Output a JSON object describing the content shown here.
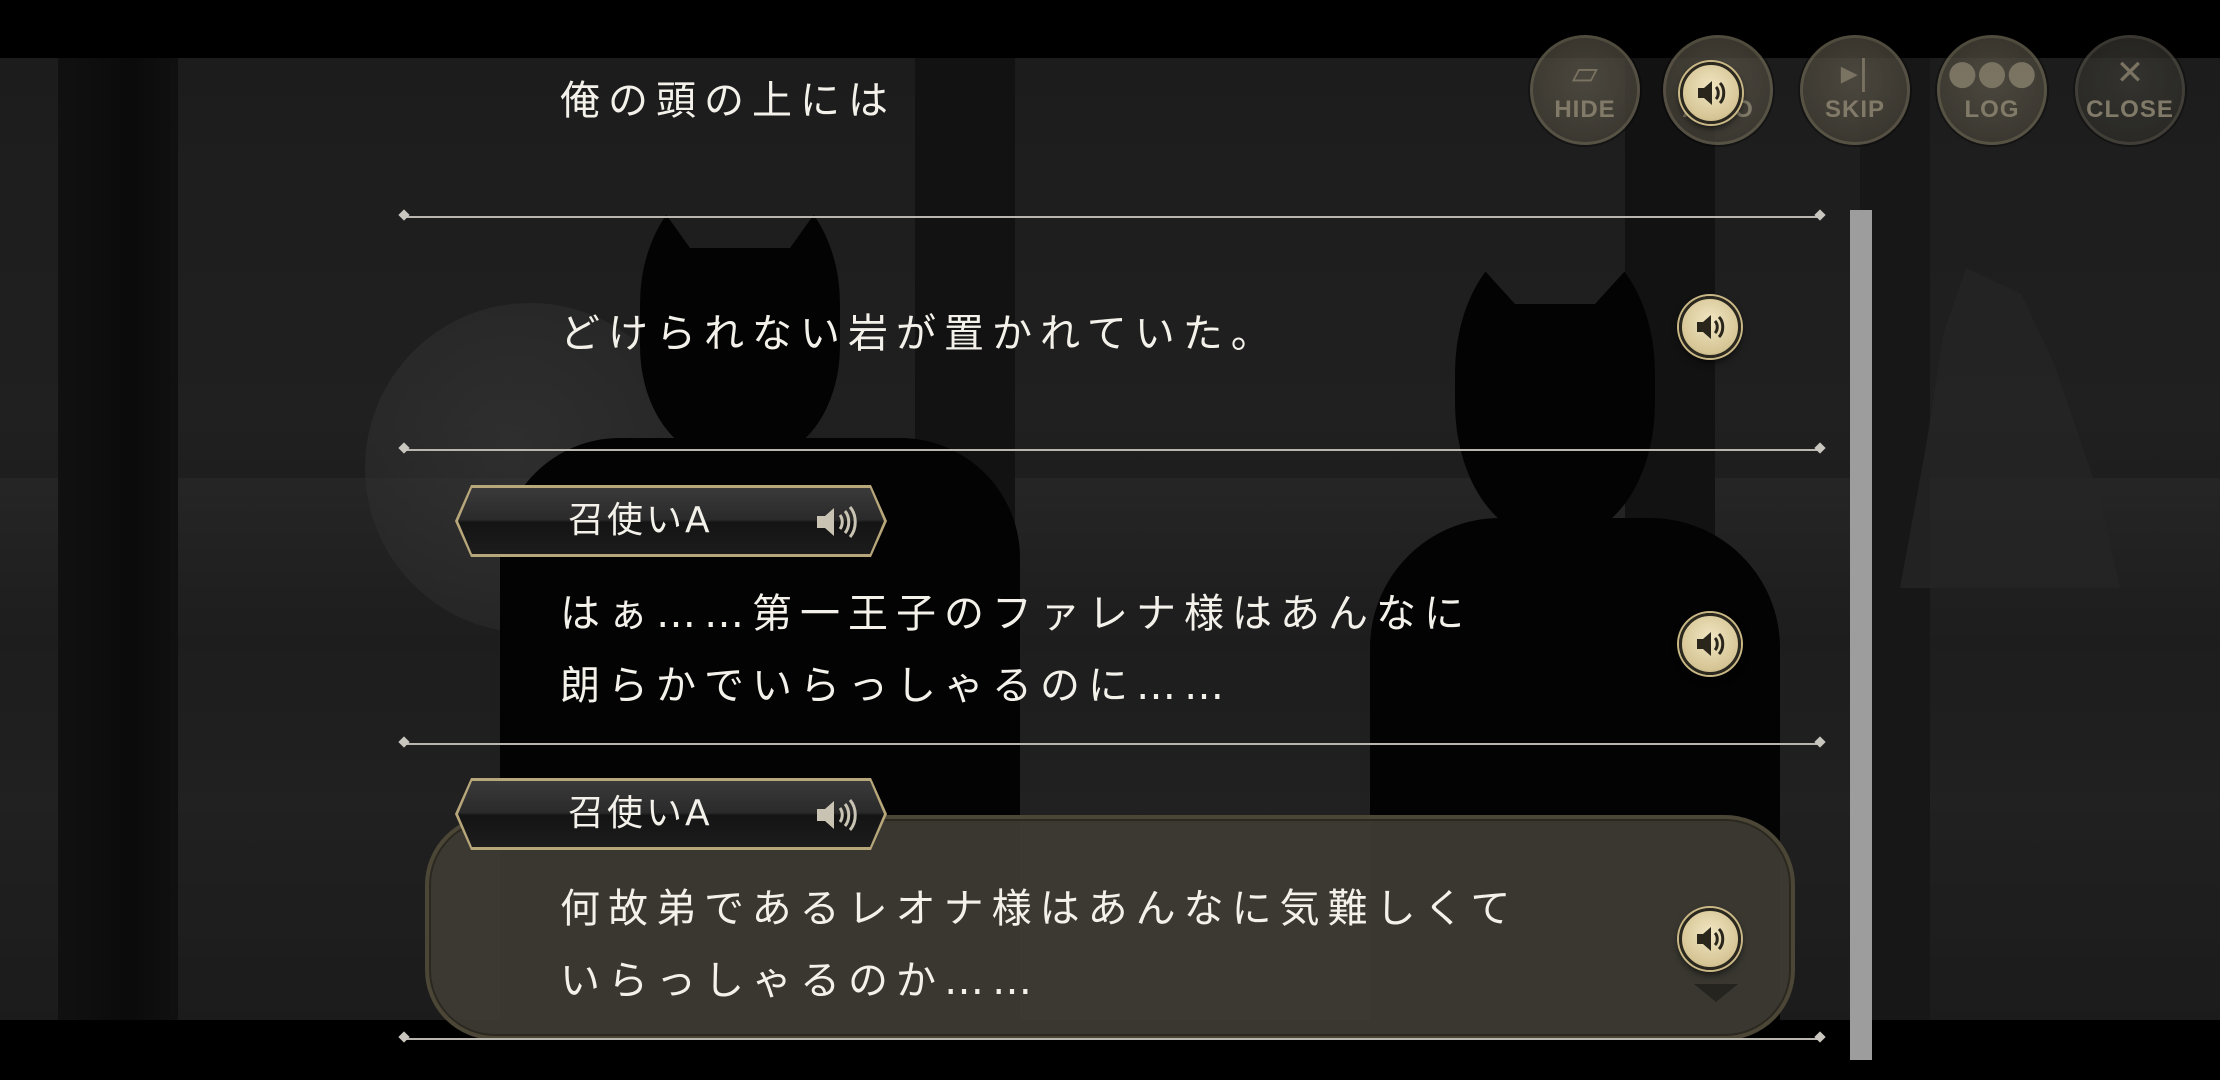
{
  "top_buttons": {
    "hide": "HIDE",
    "auto": "AUTO",
    "skip": "SKIP",
    "log": "LOG",
    "close": "CLOSE"
  },
  "log_entries": [
    {
      "speaker": "",
      "lines": [
        "俺の頭の上には"
      ]
    },
    {
      "speaker": "",
      "lines": [
        "どけられない岩が置かれていた。"
      ]
    },
    {
      "speaker": "召使いA",
      "lines": [
        "はぁ……第一王子のファレナ様はあんなに",
        "朗らかでいらっしゃるのに……"
      ]
    },
    {
      "speaker": "召使いA",
      "lines": [
        "何故弟であるレオナ様はあんなに気難しくて",
        "いらっしゃるのか……"
      ]
    }
  ],
  "colors": {
    "accent_gold": "#d6c595",
    "plate_border": "#b7a77a",
    "text": "#f3f1ea"
  }
}
